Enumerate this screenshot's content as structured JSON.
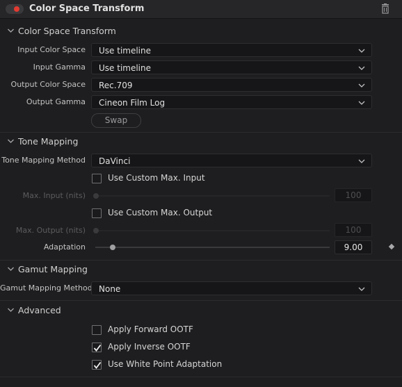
{
  "header": {
    "title": "Color Space Transform",
    "toggle_icon": "enable-toggle-icon",
    "delete_icon": "trash-icon"
  },
  "sections": {
    "csc": {
      "title": "Color Space Transform",
      "input_color_space": {
        "label": "Input Color Space",
        "value": "Use timeline"
      },
      "input_gamma": {
        "label": "Input Gamma",
        "value": "Use timeline"
      },
      "output_color_space": {
        "label": "Output Color Space",
        "value": "Rec.709"
      },
      "output_gamma": {
        "label": "Output Gamma",
        "value": "Cineon Film Log"
      },
      "swap_label": "Swap"
    },
    "tone": {
      "title": "Tone Mapping",
      "method": {
        "label": "Tone Mapping Method",
        "value": "DaVinci"
      },
      "custom_max_input": {
        "label": "Use Custom Max. Input",
        "checked": false
      },
      "max_input": {
        "label": "Max. Input (nits)",
        "value": "100"
      },
      "custom_max_output": {
        "label": "Use Custom Max. Output",
        "checked": false
      },
      "max_output": {
        "label": "Max. Output (nits)",
        "value": "100"
      },
      "adaptation": {
        "label": "Adaptation",
        "value": "9.00"
      }
    },
    "gamut": {
      "title": "Gamut Mapping",
      "method": {
        "label": "Gamut Mapping Method",
        "value": "None"
      }
    },
    "advanced": {
      "title": "Advanced",
      "apply_forward_ootf": {
        "label": "Apply Forward OOTF",
        "checked": false
      },
      "apply_inverse_ootf": {
        "label": "Apply Inverse OOTF",
        "checked": true
      },
      "white_point_adaptation": {
        "label": "Use White Point Adaptation",
        "checked": true
      }
    }
  },
  "colors": {
    "background": "#1e1e20",
    "field": "#161618",
    "toggle_dot": "#e23b32",
    "text": "#c9c9c9"
  }
}
